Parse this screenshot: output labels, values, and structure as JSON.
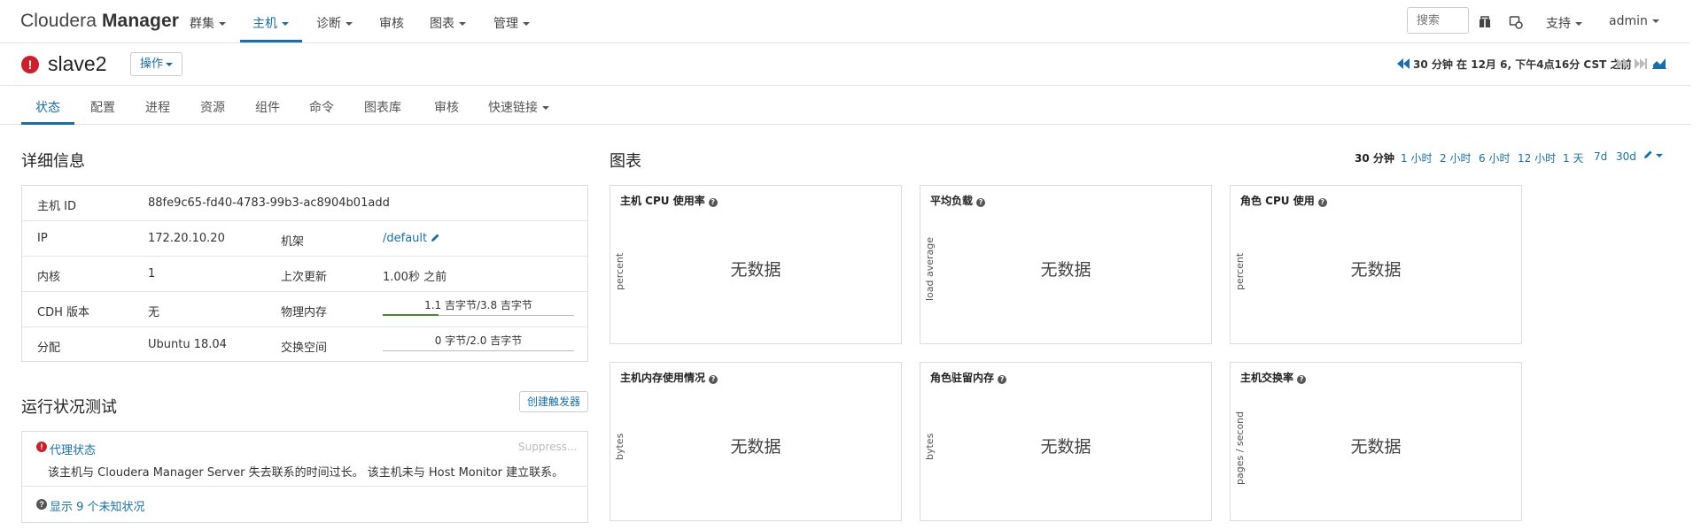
{
  "brand": {
    "part1": "Cloudera",
    "part2": "Manager"
  },
  "nav": {
    "items": [
      {
        "label": "群集",
        "dropdown": true
      },
      {
        "label": "主机",
        "dropdown": true,
        "active": true
      },
      {
        "label": "诊断",
        "dropdown": true
      },
      {
        "label": "审核",
        "dropdown": false
      },
      {
        "label": "图表",
        "dropdown": true
      },
      {
        "label": "管理",
        "dropdown": true
      }
    ],
    "search_placeholder": "搜索",
    "support": "支持",
    "user": "admin"
  },
  "header": {
    "host_name": "slave2",
    "actions_label": "操作",
    "time_text": "30 分钟 在 12月 6, 下午4点16分 CST 之前"
  },
  "tabs": [
    {
      "label": "状态",
      "active": true
    },
    {
      "label": "配置"
    },
    {
      "label": "进程"
    },
    {
      "label": "资源"
    },
    {
      "label": "组件"
    },
    {
      "label": "命令"
    },
    {
      "label": "图表库"
    },
    {
      "label": "审核"
    },
    {
      "label": "快速链接",
      "dropdown": true
    }
  ],
  "details": {
    "title": "详细信息",
    "host_id_label": "主机 ID",
    "host_id": "88fe9c65-fd40-4783-99b3-ac8904b01add",
    "ip_label": "IP",
    "ip": "172.20.10.20",
    "rack_label": "机架",
    "rack": "/default",
    "cores_label": "内核",
    "cores": "1",
    "last_update_label": "上次更新",
    "last_update": "1.00秒 之前",
    "cdh_label": "CDH 版本",
    "cdh": "无",
    "mem_label": "物理内存",
    "mem_text": "1.1 吉字节/3.8 吉字节",
    "mem_fraction": 0.29,
    "dist_label": "分配",
    "dist": "Ubuntu 18.04",
    "swap_label": "交换空间",
    "swap_text": "0 字节/2.0 吉字节",
    "swap_fraction": 0
  },
  "health": {
    "title": "运行状况测试",
    "create_trigger": "创建触发器",
    "test_name": "代理状态",
    "suppress": "Suppress...",
    "description": "该主机与 Cloudera Manager Server 失去联系的时间过长。 该主机未与 Host Monitor 建立联系。",
    "show_unknown": "显示 9 个未知状况"
  },
  "charts": {
    "title": "图表",
    "ranges": [
      "30 分钟",
      "1 小时",
      "2 小时",
      "6 小时",
      "12 小时",
      "1 天",
      "7d",
      "30d"
    ],
    "active_range": "30 分钟",
    "no_data": "无数据",
    "cards": [
      {
        "title": "主机 CPU 使用率",
        "ylabel": "percent"
      },
      {
        "title": "平均负载",
        "ylabel": "load average"
      },
      {
        "title": "角色 CPU 使用",
        "ylabel": "percent"
      },
      {
        "title": "主机内存使用情况",
        "ylabel": "bytes"
      },
      {
        "title": "角色驻留内存",
        "ylabel": "bytes"
      },
      {
        "title": "主机交换率",
        "ylabel": "pages / second"
      }
    ]
  },
  "colors": {
    "accent": "#1a6ea8",
    "alert": "#c9202b",
    "meter": "#4a8a2a"
  }
}
